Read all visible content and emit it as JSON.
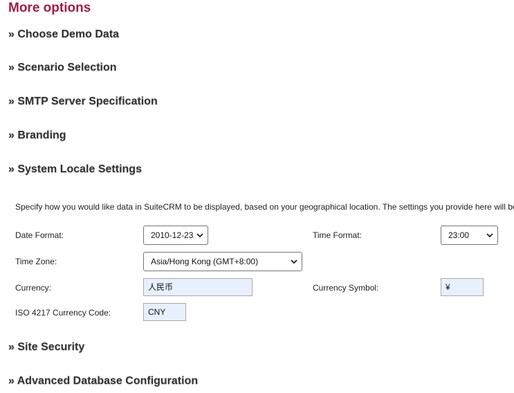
{
  "title": "More options",
  "sections": {
    "demo_data": "» Choose Demo Data",
    "scenario": "» Scenario Selection",
    "smtp": "» SMTP Server Specification",
    "branding": "» Branding",
    "locale": "» System Locale Settings",
    "site_security": "» Site Security",
    "advanced_db": "» Advanced Database Configuration"
  },
  "locale": {
    "description": "Specify how you would like data in SuiteCRM to be displayed, based on your geographical location. The settings you provide here will be",
    "date_format_label": "Date Format:",
    "date_format_value": "2010-12-23",
    "time_format_label": "Time Format:",
    "time_format_value": "23:00",
    "time_zone_label": "Time Zone:",
    "time_zone_value": "Asia/Hong Kong (GMT+8:00)",
    "currency_label": "Currency:",
    "currency_value": "人民币",
    "currency_symbol_label": "Currency Symbol:",
    "currency_symbol_value": "¥",
    "iso_code_label": "ISO 4217 Currency Code:",
    "iso_code_value": "CNY"
  },
  "colors": {
    "title": "#a5194a",
    "input_bg": "#e8f0fe"
  },
  "icons": {
    "select_arrow": "chevron-down-icon"
  }
}
